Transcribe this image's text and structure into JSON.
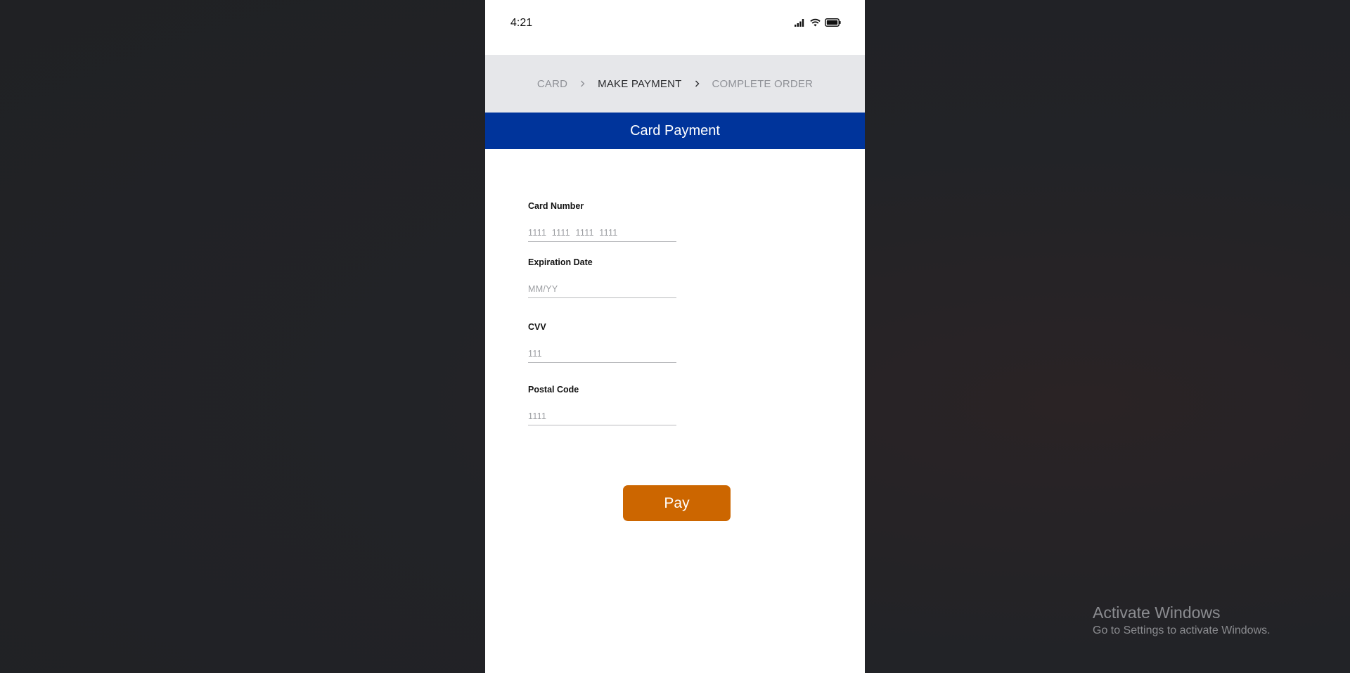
{
  "status_bar": {
    "time": "4:21",
    "icons": [
      "signal-icon",
      "wifi-icon",
      "battery-icon"
    ]
  },
  "breadcrumb": {
    "steps": [
      "CARD",
      "MAKE PAYMENT",
      "COMPLETE ORDER"
    ],
    "active_step": "MAKE PAYMENT"
  },
  "header": {
    "title": "Card Payment",
    "color": "#00349b"
  },
  "form": {
    "card_number": {
      "label": "Card Number",
      "placeholder": "1111  1111  1111  1111",
      "value": ""
    },
    "expiration_date": {
      "label": "Expiration Date",
      "placeholder": "MM/YY",
      "value": ""
    },
    "cvv": {
      "label": "CVV",
      "placeholder": "111",
      "value": ""
    },
    "postal_code": {
      "label": "Postal Code",
      "placeholder": "1111",
      "value": ""
    }
  },
  "pay_button": {
    "label": "Pay",
    "color": "#cc6600"
  },
  "windows_watermark": {
    "title": "Activate Windows",
    "subtitle": "Go to Settings to activate Windows."
  }
}
